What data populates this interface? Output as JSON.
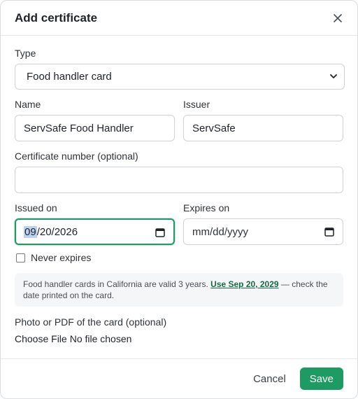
{
  "dialog": {
    "title": "Add certificate",
    "close_icon": "close-icon"
  },
  "type": {
    "label": "Type",
    "value": "Food handler card"
  },
  "name": {
    "label": "Name",
    "value": "ServSafe Food Handler"
  },
  "issuer": {
    "label": "Issuer",
    "value": "ServSafe"
  },
  "cert_number": {
    "label": "Certificate number (optional)",
    "value": ""
  },
  "issued_on": {
    "label": "Issued on",
    "month": "09",
    "rest": "/20/2026"
  },
  "expires_on": {
    "label": "Expires on",
    "value": "mm/dd/yyyy"
  },
  "never_expires": {
    "label": "Never expires"
  },
  "note": {
    "text_before": "Food handler cards in California are valid 3 years.",
    "link": "Use Sep 20, 2029",
    "text_after": "— check the date printed on the card."
  },
  "file": {
    "label": "Photo or PDF of the card (optional)",
    "button": "Choose File",
    "status": "No file chosen"
  },
  "footer": {
    "cancel": "Cancel",
    "save": "Save"
  },
  "colors": {
    "accent": "#1e9b63",
    "link": "#146c43"
  }
}
